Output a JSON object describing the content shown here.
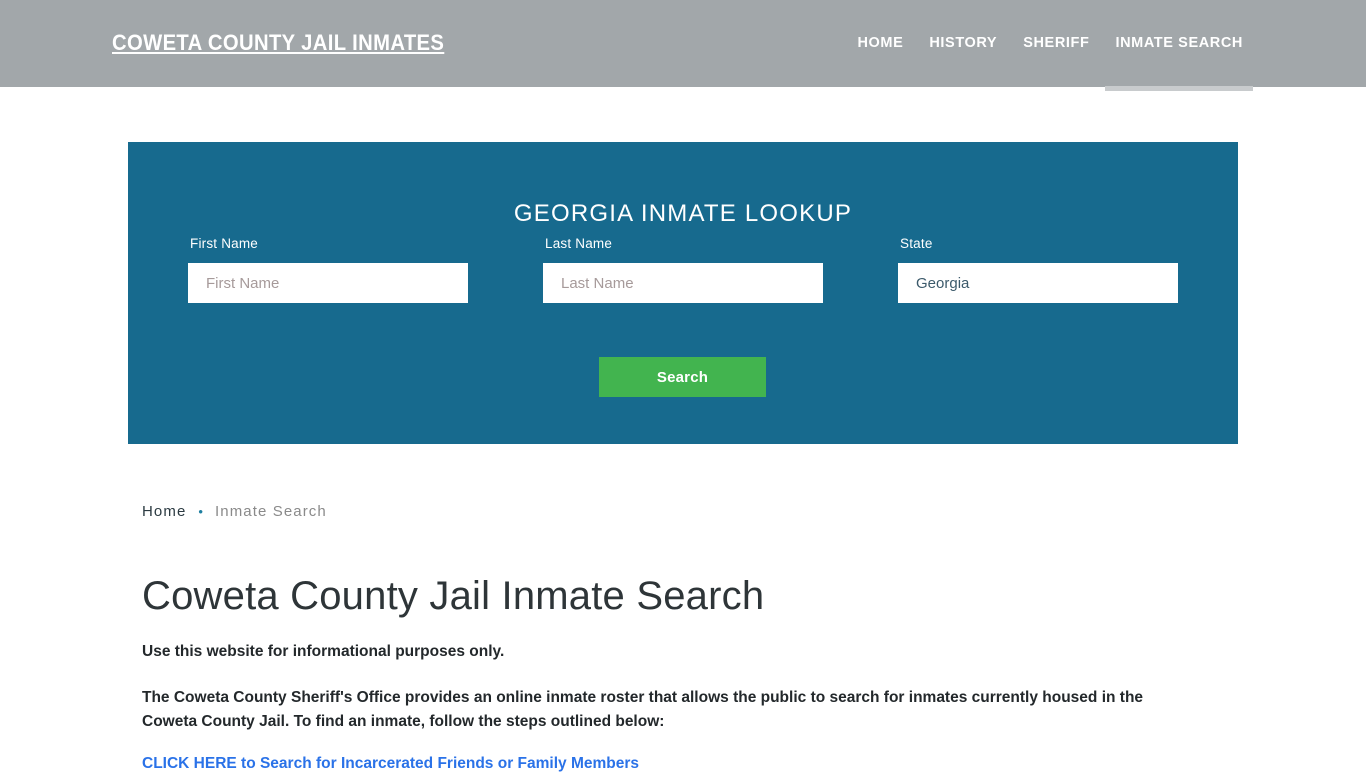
{
  "header": {
    "brand": "COWETA COUNTY JAIL INMATES",
    "nav": [
      {
        "label": "HOME",
        "active": false
      },
      {
        "label": "HISTORY",
        "active": false
      },
      {
        "label": "SHERIFF",
        "active": false
      },
      {
        "label": "INMATE SEARCH",
        "active": true
      }
    ],
    "background_color": "#a2a7aa"
  },
  "search_panel": {
    "title": "GEORGIA INMATE LOOKUP",
    "background_color": "#176a8e",
    "fields": [
      {
        "label": "First Name",
        "placeholder": "First Name",
        "value": ""
      },
      {
        "label": "Last Name",
        "placeholder": "Last Name",
        "value": ""
      },
      {
        "label": "State",
        "placeholder": "State",
        "value": "Georgia"
      }
    ],
    "submit_label": "Search",
    "submit_color": "#42b44f"
  },
  "breadcrumb": {
    "home": "Home",
    "separator": "•",
    "current": "Inmate Search"
  },
  "main": {
    "title": "Coweta County Jail Inmate Search",
    "notice": "Use this website for informational purposes only.",
    "paragraph": "The Coweta County Sheriff's Office provides an online inmate roster that allows the public to search for inmates currently housed in the Coweta County Jail. To find an inmate, follow the steps outlined below:",
    "cta_link": "CLICK HERE to Search for Incarcerated Friends or Family Members",
    "link_color": "#2a72e8"
  }
}
